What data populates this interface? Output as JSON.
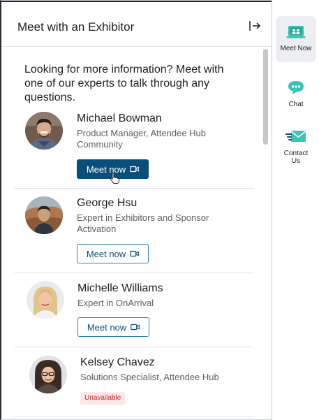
{
  "panel": {
    "title": "Meet with an Exhibitor",
    "intro": "Looking for more information? Meet with one of our experts to talk through any questions."
  },
  "experts": [
    {
      "name": "Michael Bowman",
      "role": "Product Manager, Attendee Hub Community",
      "action": "Meet now",
      "state": "hovered"
    },
    {
      "name": "George Hsu",
      "role": "Expert in Exhibitors and Sponsor Activation",
      "action": "Meet now",
      "state": "default"
    },
    {
      "name": "Michelle Williams",
      "role": "Expert in OnArrival",
      "action": "Meet now",
      "state": "default"
    },
    {
      "name": "Kelsey Chavez",
      "role": "Solutions Specialist, Attendee Hub",
      "status": "Unavailable"
    }
  ],
  "rail": {
    "items": [
      {
        "label": "Meet Now",
        "icon": "video-meeting-icon",
        "active": true
      },
      {
        "label": "Chat",
        "icon": "chat-bubble-icon",
        "active": false
      },
      {
        "label": "Contact Us",
        "icon": "email-icon",
        "active": false
      }
    ]
  },
  "colors": {
    "primary": "#0a4f79",
    "accent_teal": "#39c4b5",
    "unavailable_bg": "#fde8e8",
    "unavailable_text": "#c1272d"
  }
}
